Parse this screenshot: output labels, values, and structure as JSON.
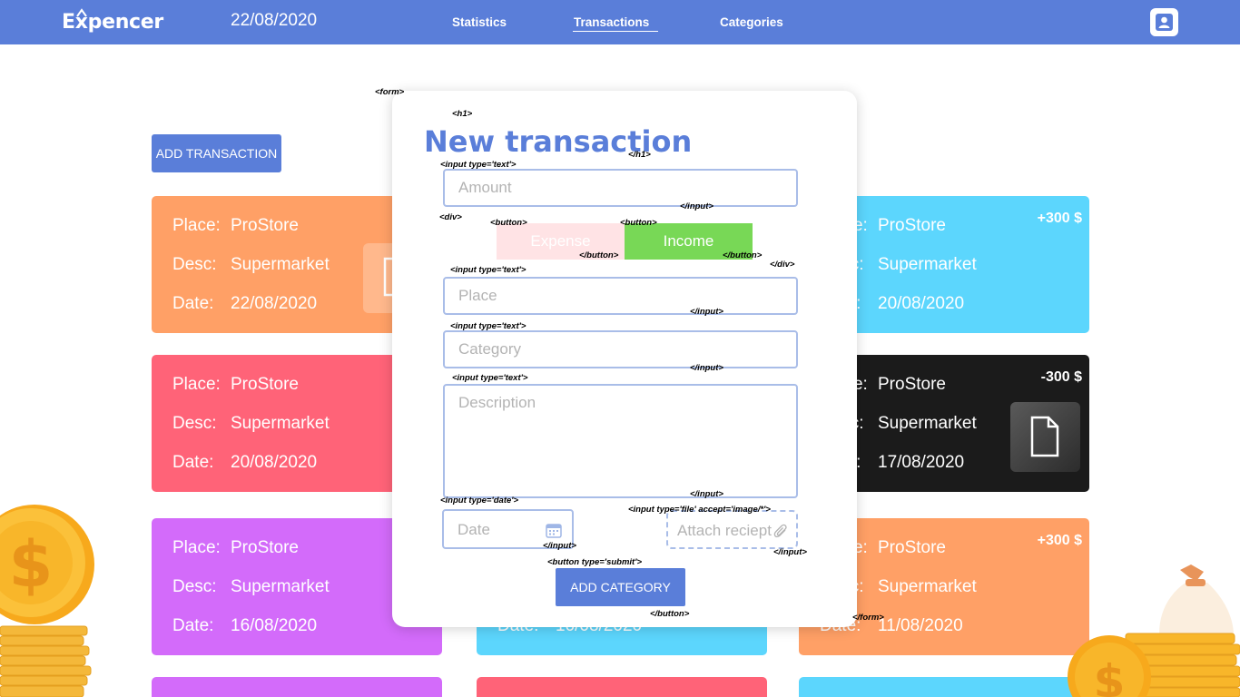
{
  "header": {
    "logo": "Expencer",
    "date": "22/08/2020",
    "nav": {
      "statistics": "Statistics",
      "transactions": "Transactions",
      "categories": "Categories"
    },
    "profile_icon": "user-icon"
  },
  "add_transaction_label": "ADD TRANSACTION",
  "card_labels": {
    "place": "Place:",
    "desc": "Desc:",
    "date": "Date:"
  },
  "cards": [
    {
      "color": "#ffa066",
      "place": "ProStore",
      "desc": "Supermarket",
      "date": "22/08/2020"
    },
    {
      "color": "#5cd6fd",
      "place": "ProStore",
      "desc": "Supermarket",
      "date": "20/08/2020",
      "amount": "+300 $"
    },
    {
      "color": "#ff6378",
      "place": "ProStore",
      "desc": "Supermarket",
      "date": "20/08/2020"
    },
    {
      "color": "#1b1b1b",
      "place": "ProStore",
      "desc": "Supermarket",
      "date": "17/08/2020",
      "amount": "-300 $"
    },
    {
      "color": "#d36bfa",
      "place": "ProStore",
      "desc": "Supermarket",
      "date": "16/08/2020"
    },
    {
      "color": "#5cd6fd",
      "date": "10/08/2020"
    },
    {
      "color": "#ffa066",
      "place": "ProStore",
      "desc": "Supermarket",
      "date": "11/08/2020",
      "amount": "+300 $"
    }
  ],
  "modal": {
    "title": "New transaction",
    "amount_placeholder": "Amount",
    "expense_label": "Expense",
    "income_label": "Income",
    "place_placeholder": "Place",
    "category_placeholder": "Category",
    "description_placeholder": "Description",
    "date_placeholder": "Date",
    "attach_placeholder": "Attach reciept",
    "submit_label": "ADD CATEGORY"
  },
  "annotations": {
    "form_open": "<form>",
    "h1_open": "<h1>",
    "h1_close": "</h1>",
    "input_text_1": "<input type='text'>",
    "input_close_1": "</input>",
    "div_open": "<div>",
    "button_open_1": "<button>",
    "button_open_2": "<button>",
    "button_close_1": "</button>",
    "button_close_2": "</button>",
    "div_close": "</div>",
    "input_text_2": "<input type='text'>",
    "input_close_2": "</input>",
    "input_text_3": "<input type='text'>",
    "input_close_3": "</input>",
    "input_text_4": "<input type='text'>",
    "input_close_4": "</input>",
    "input_date": "<input type='date'>",
    "input_close_5": "</input>",
    "input_file": "<input type='file' accept='image/*'>",
    "input_close_6": "</input>",
    "button_submit": "<button type='submit'>",
    "button_close_3": "</button>",
    "form_close": "</form>"
  },
  "colors": {
    "brand": "#5a7ed9",
    "income": "#78d856",
    "expense_light": "#ffe3e5"
  }
}
